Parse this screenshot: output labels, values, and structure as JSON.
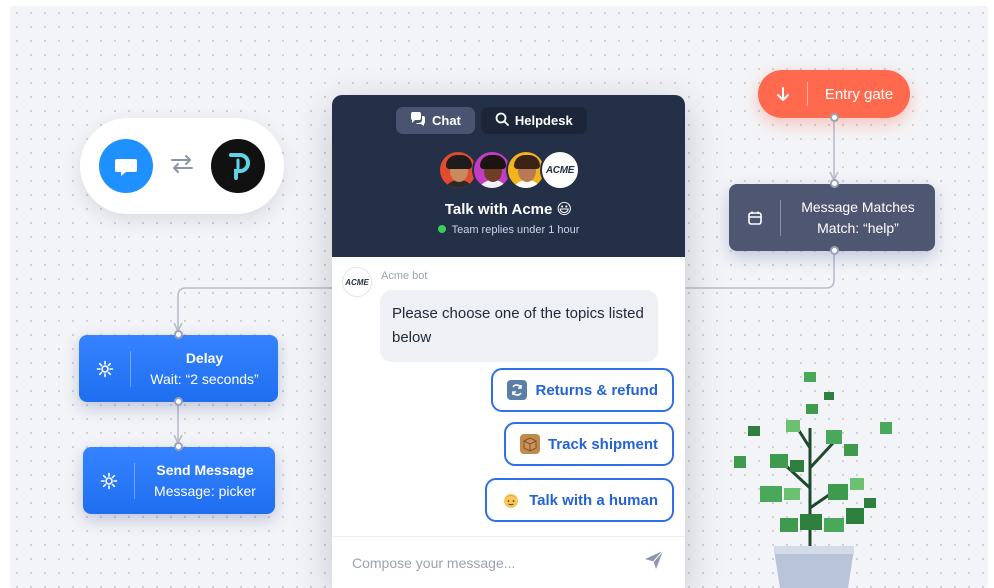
{
  "integration": {
    "left_icon": "chat-bubble-icon",
    "swap_icon": "swap-arrows-icon",
    "right_icon": "p-logo-icon"
  },
  "flow": {
    "entry_gate": {
      "label": "Entry gate",
      "icon": "arrow-down-icon"
    },
    "message_matches": {
      "title": "Message Matches",
      "subtitle": "Match: “help”",
      "icon": "calendar-icon"
    },
    "delay": {
      "title": "Delay",
      "subtitle": "Wait: “2 seconds”",
      "icon": "gear-icon"
    },
    "send_message": {
      "title": "Send Message",
      "subtitle": "Message: picker",
      "icon": "gear-icon"
    }
  },
  "chat": {
    "tabs": [
      {
        "label": "Chat",
        "icon": "chat-icon",
        "active": true
      },
      {
        "label": "Helpdesk",
        "icon": "search-icon",
        "active": false
      }
    ],
    "avatar_logo": "ACME",
    "title": "Talk with Acme 😃",
    "status": "Team replies under 1 hour",
    "bot_avatar_text": "ACME",
    "bot_name": "Acme bot",
    "message": "Please choose one of the topics listed below",
    "options": [
      {
        "label": "Returns & refund",
        "emoji": "🔄"
      },
      {
        "label": "Track shipment",
        "emoji": "📦"
      },
      {
        "label": "Talk with a human",
        "emoji": "👱"
      }
    ],
    "composer_placeholder": "Compose your message...",
    "send_icon": "send-icon"
  },
  "colors": {
    "header": "#243048",
    "accent": "#2f6fe8",
    "entry": "#ff6a4f",
    "node_blue": "#2a7bff",
    "node_dark": "#4f5671"
  }
}
